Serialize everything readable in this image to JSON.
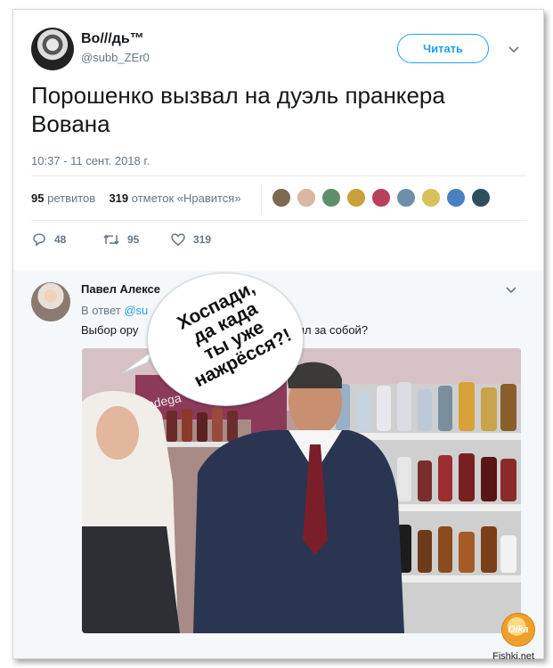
{
  "tweet": {
    "author_name": "Во///дь™",
    "author_handle": "@subb_ZEr0",
    "follow_label": "Читать",
    "text": "Порошенко вызвал на дуэль пранкера Вована",
    "time": "10:37 - 11 сент. 2018 г.",
    "retweets_count": "95",
    "retweets_label": "ретвитов",
    "likes_count": "319",
    "likes_label": "отметок «Нравится»",
    "actions": {
      "replies": "48",
      "retweets": "95",
      "likes": "319"
    }
  },
  "reply": {
    "author_name": "Павел Алексе",
    "author_tail": "...",
    "reply_prefix": "В ответ",
    "reply_handle": "@su",
    "text_left": "Выбор ору",
    "text_right": "авил за собой?"
  },
  "bubble": {
    "lines": [
      "Хоспади,",
      "да када",
      "ты уже",
      "нажрёсся?!"
    ]
  },
  "photo": {
    "store_sign": "Bodega"
  },
  "watermark": {
    "logo_text": "Ŋika",
    "site": "Fishki.net"
  },
  "colors": {
    "accent": "#1da1f2",
    "secondary_text": "#657786",
    "reply_bg": "#f5f8fa"
  },
  "icons": [
    "reply-icon",
    "retweet-icon",
    "like-icon",
    "chevron-down-icon"
  ]
}
